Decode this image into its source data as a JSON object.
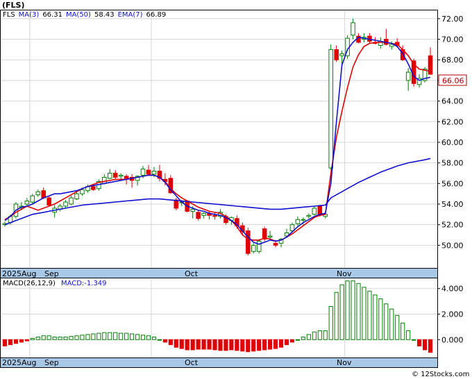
{
  "header": {
    "symbol": "(FLS)",
    "legend_ticker": "FLS",
    "ma3_label": "MA(3)",
    "ma3_value": "66.31",
    "ma50_label": "MA(50)",
    "ma50_value": "58.43",
    "ema7_label": "EMA(7)",
    "ema7_value": "66.89"
  },
  "last_price_label": "66.06",
  "macd_header": {
    "label": "MACD(26,12,9)",
    "value_label": "MACD:-1.349"
  },
  "date_labels": {
    "aug": "2025Aug",
    "sep": "Sep",
    "oct": "Oct",
    "nov": "Nov"
  },
  "credit": "© 12Stocks.com",
  "colors": {
    "up": "#008000",
    "down": "#e00000",
    "ema": "#e00000",
    "ma": "#1010d0",
    "axis_band": "#a8c8e8"
  },
  "chart_data": [
    {
      "type": "candlestick",
      "ylim": [
        47.8,
        72.8
      ],
      "y_ticks": [
        50,
        52,
        54,
        56,
        58,
        60,
        62,
        64,
        66,
        68,
        70,
        72
      ],
      "y_tick_labels": [
        "50.00",
        "52.00",
        "54.00",
        "56.00",
        "58.00",
        "60.00",
        "62.00",
        "64.00",
        "66.00",
        "68.00",
        "70.00",
        "72.00"
      ],
      "ohlc": [
        [
          52.0,
          52.3,
          51.8,
          52.1
        ],
        [
          52.2,
          53.0,
          52.0,
          52.8
        ],
        [
          52.8,
          54.2,
          52.6,
          54.0
        ],
        [
          53.6,
          54.2,
          53.4,
          53.8
        ],
        [
          54.0,
          54.6,
          53.8,
          54.3
        ],
        [
          54.2,
          55.0,
          54.0,
          54.8
        ],
        [
          54.9,
          55.4,
          54.7,
          55.2
        ],
        [
          55.3,
          55.6,
          54.5,
          54.6
        ],
        [
          54.6,
          54.8,
          53.8,
          53.9
        ],
        [
          53.2,
          53.9,
          52.7,
          53.6
        ],
        [
          53.5,
          54.0,
          53.3,
          53.8
        ],
        [
          53.8,
          54.4,
          53.6,
          54.2
        ],
        [
          54.0,
          54.8,
          53.9,
          54.6
        ],
        [
          54.5,
          55.3,
          54.4,
          55.0
        ],
        [
          55.0,
          55.6,
          54.8,
          55.4
        ],
        [
          55.3,
          55.9,
          55.1,
          55.7
        ],
        [
          55.7,
          55.9,
          55.3,
          55.4
        ],
        [
          55.5,
          56.4,
          55.3,
          56.2
        ],
        [
          56.0,
          56.9,
          55.9,
          56.6
        ],
        [
          56.5,
          57.4,
          56.4,
          57.0
        ],
        [
          57.0,
          57.3,
          56.4,
          56.6
        ],
        [
          56.7,
          57.0,
          56.4,
          56.8
        ],
        [
          56.7,
          56.9,
          55.9,
          56.5
        ],
        [
          56.6,
          56.9,
          55.6,
          56.3
        ],
        [
          56.3,
          56.8,
          55.8,
          56.7
        ],
        [
          56.8,
          57.7,
          56.5,
          57.4
        ],
        [
          57.3,
          57.8,
          56.8,
          56.9
        ],
        [
          56.9,
          57.6,
          56.6,
          57.2
        ],
        [
          57.2,
          57.8,
          56.2,
          56.5
        ],
        [
          56.4,
          57.0,
          55.8,
          56.2
        ],
        [
          56.5,
          56.8,
          55.0,
          55.1
        ],
        [
          54.4,
          54.6,
          53.4,
          53.6
        ],
        [
          54.2,
          54.4,
          53.8,
          54.2
        ],
        [
          54.3,
          54.4,
          53.2,
          53.3
        ],
        [
          53.3,
          53.8,
          52.6,
          53.5
        ],
        [
          53.2,
          53.4,
          52.4,
          52.6
        ],
        [
          52.9,
          53.2,
          52.6,
          53.1
        ],
        [
          53.1,
          53.3,
          52.5,
          52.9
        ],
        [
          52.9,
          53.2,
          52.5,
          52.8
        ],
        [
          52.8,
          53.5,
          52.6,
          53.2
        ],
        [
          52.8,
          53.0,
          52.0,
          52.2
        ],
        [
          52.4,
          52.8,
          52.0,
          52.7
        ],
        [
          52.6,
          52.9,
          51.6,
          51.9
        ],
        [
          51.9,
          52.2,
          51.0,
          51.3
        ],
        [
          51.4,
          51.7,
          49.0,
          49.2
        ],
        [
          49.4,
          50.2,
          49.2,
          50.0
        ],
        [
          49.4,
          50.6,
          49.2,
          50.4
        ],
        [
          51.6,
          51.8,
          50.4,
          50.6
        ],
        [
          50.8,
          51.4,
          50.6,
          50.9
        ],
        [
          50.2,
          50.5,
          49.8,
          50.0
        ],
        [
          50.2,
          50.7,
          49.8,
          50.6
        ],
        [
          50.9,
          51.6,
          50.7,
          51.2
        ],
        [
          51.4,
          52.2,
          51.2,
          52.0
        ],
        [
          52.1,
          52.8,
          51.9,
          52.5
        ],
        [
          52.5,
          52.7,
          52.0,
          52.5
        ],
        [
          52.8,
          53.1,
          52.6,
          52.9
        ],
        [
          53.0,
          53.8,
          52.9,
          53.6
        ],
        [
          53.8,
          53.9,
          52.8,
          53.0
        ],
        [
          52.8,
          53.3,
          52.6,
          53.0
        ],
        [
          57.5,
          69.5,
          57.3,
          69.0
        ],
        [
          69.0,
          69.4,
          67.8,
          68.0
        ],
        [
          68.4,
          68.9,
          67.6,
          68.6
        ],
        [
          68.4,
          70.4,
          68.1,
          70.1
        ],
        [
          70.4,
          72.0,
          70.0,
          71.6
        ],
        [
          70.3,
          70.6,
          69.6,
          69.7
        ],
        [
          70.0,
          70.6,
          69.7,
          70.2
        ],
        [
          70.3,
          70.6,
          69.6,
          69.8
        ],
        [
          69.7,
          70.2,
          69.5,
          69.6
        ],
        [
          69.4,
          70.2,
          69.1,
          69.8
        ],
        [
          70.0,
          71.0,
          69.4,
          69.5
        ],
        [
          69.3,
          69.8,
          69.0,
          69.5
        ],
        [
          69.7,
          70.1,
          69.2,
          69.4
        ],
        [
          69.0,
          69.4,
          67.9,
          68.0
        ],
        [
          66.0,
          67.2,
          65.0,
          66.8
        ],
        [
          67.9,
          68.1,
          65.4,
          65.7
        ],
        [
          65.6,
          66.6,
          65.3,
          66.2
        ],
        [
          66.0,
          67.3,
          65.8,
          67.1
        ],
        [
          68.4,
          69.2,
          66.6,
          66.6
        ]
      ],
      "ema7": [
        52.5,
        52.8,
        53.2,
        53.5,
        53.8,
        53.6,
        53.4,
        53.6,
        53.8,
        54.0,
        54.3,
        54.6,
        54.9,
        55.2,
        55.5,
        55.7,
        55.9,
        56.1,
        56.2,
        56.3,
        56.4,
        56.4,
        56.4,
        56.5,
        56.6,
        56.7,
        56.8,
        56.8,
        56.6,
        56.2,
        55.5,
        55.0,
        54.6,
        54.3,
        54.0,
        53.7,
        53.5,
        53.3,
        53.2,
        53.1,
        52.8,
        52.4,
        51.8,
        51.0,
        50.6,
        50.5,
        50.5,
        50.7,
        50.6,
        50.4,
        50.5,
        50.8,
        51.1,
        51.5,
        51.9,
        52.3,
        52.7,
        52.9,
        53.0,
        57.0,
        60.5,
        63.0,
        65.3,
        67.3,
        68.5,
        69.3,
        69.6,
        69.7,
        69.7,
        69.7,
        69.6,
        69.5,
        69.0,
        68.4,
        67.6,
        67.1,
        67.0,
        66.9
      ],
      "ma3": [
        52.4,
        52.8,
        53.4,
        53.7,
        53.8,
        54.0,
        54.3,
        54.6,
        54.8,
        55.0,
        55.0,
        55.1,
        55.2,
        55.3,
        55.5,
        55.7,
        55.8,
        55.9,
        56.0,
        56.1,
        56.2,
        56.3,
        56.4,
        56.5,
        56.6,
        56.7,
        56.8,
        56.8,
        56.6,
        56.1,
        55.4,
        54.8,
        54.2,
        53.8,
        53.6,
        53.4,
        53.3,
        53.1,
        53.0,
        52.9,
        52.7,
        52.4,
        52.0,
        51.4,
        50.8,
        50.3,
        50.1,
        50.3,
        50.5,
        50.4,
        50.5,
        50.8,
        51.3,
        51.8,
        52.2,
        52.5,
        52.8,
        53.0,
        53.1,
        56.0,
        62.0,
        67.5,
        69.0,
        69.7,
        70.2,
        70.1,
        70.0,
        69.9,
        69.8,
        69.7,
        69.6,
        69.3,
        68.6,
        67.6,
        66.4,
        66.0,
        66.2,
        66.3
      ],
      "ma50": [
        52.0,
        52.2,
        52.4,
        52.6,
        52.8,
        53.0,
        53.1,
        53.2,
        53.3,
        53.4,
        53.5,
        53.6,
        53.7,
        53.8,
        53.9,
        53.95,
        54.0,
        54.05,
        54.1,
        54.15,
        54.2,
        54.25,
        54.3,
        54.35,
        54.4,
        54.45,
        54.5,
        54.5,
        54.5,
        54.45,
        54.4,
        54.35,
        54.3,
        54.25,
        54.2,
        54.15,
        54.1,
        54.05,
        54.0,
        53.95,
        53.9,
        53.85,
        53.8,
        53.75,
        53.7,
        53.65,
        53.6,
        53.55,
        53.5,
        53.5,
        53.5,
        53.55,
        53.6,
        53.65,
        53.7,
        53.75,
        53.8,
        53.85,
        53.9,
        54.6,
        54.9,
        55.2,
        55.5,
        55.8,
        56.1,
        56.35,
        56.6,
        56.85,
        57.1,
        57.3,
        57.5,
        57.7,
        57.85,
        58.0,
        58.1,
        58.2,
        58.3,
        58.43
      ]
    },
    {
      "type": "bar",
      "title": "MACD(26,12,9)",
      "ylim": [
        -1.4,
        4.8
      ],
      "y_ticks": [
        0,
        2,
        4
      ],
      "y_tick_labels": [
        "0.000",
        "2.000",
        "4.000"
      ],
      "values": [
        -0.5,
        -0.4,
        -0.3,
        -0.2,
        -0.1,
        0.1,
        0.2,
        0.3,
        0.3,
        0.2,
        0.2,
        0.2,
        0.25,
        0.3,
        0.35,
        0.4,
        0.45,
        0.5,
        0.55,
        0.55,
        0.55,
        0.5,
        0.5,
        0.45,
        0.4,
        0.35,
        0.3,
        0.2,
        0.0,
        -0.2,
        -0.4,
        -0.6,
        -0.7,
        -0.8,
        -0.8,
        -0.75,
        -0.75,
        -0.75,
        -0.8,
        -0.85,
        -0.85,
        -0.8,
        -0.85,
        -0.9,
        -0.95,
        -0.9,
        -0.85,
        -0.8,
        -0.75,
        -0.7,
        -0.6,
        -0.4,
        -0.2,
        0.0,
        0.2,
        0.4,
        0.6,
        0.7,
        0.7,
        2.6,
        3.7,
        4.3,
        4.6,
        4.6,
        4.4,
        4.1,
        3.8,
        3.5,
        3.2,
        2.8,
        2.4,
        1.9,
        1.3,
        0.7,
        0.0,
        -0.5,
        -0.8,
        -1.0
      ]
    }
  ]
}
